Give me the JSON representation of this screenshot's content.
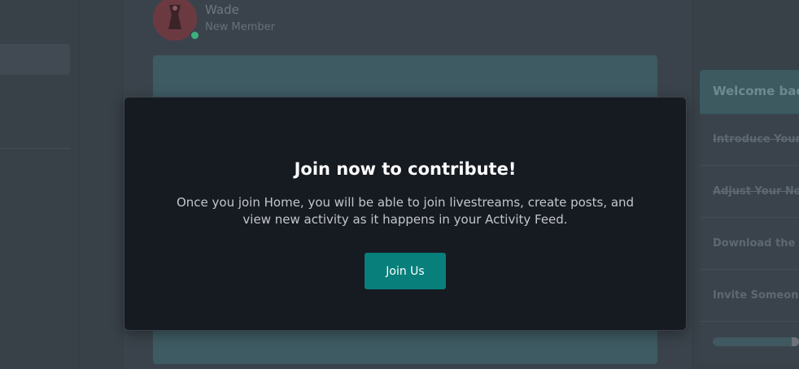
{
  "post": {
    "author_name": "Wade",
    "author_role": "New Member"
  },
  "sidebar_right": {
    "header": "Welcome bac",
    "items": [
      {
        "label": "Introduce Yours"
      },
      {
        "label": "Adjust Your Not"
      },
      {
        "label": "Download the A"
      },
      {
        "label": "Invite Someone"
      }
    ]
  },
  "modal": {
    "title": "Join now to contribute!",
    "body": "Once you join Home, you will be able to join livestreams, create posts, and view new activity as it happens in your Activity Feed.",
    "button_label": "Join Us"
  },
  "colors": {
    "accent": "#087f7b",
    "modal_bg": "#161a21",
    "online_status": "#3fae7d"
  }
}
